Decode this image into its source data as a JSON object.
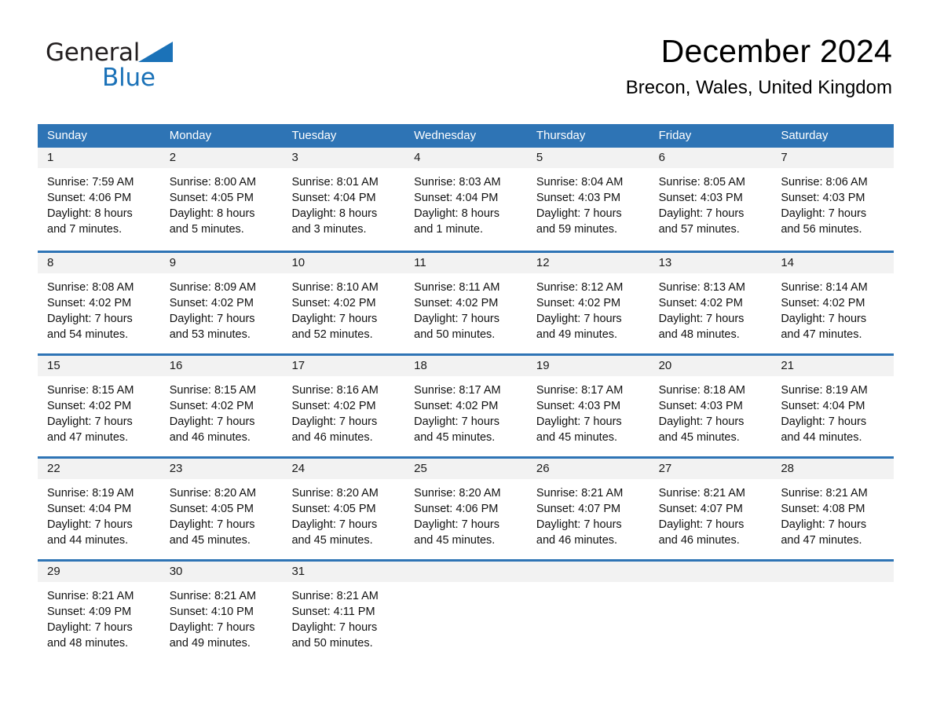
{
  "brand": {
    "name_part1": "General",
    "name_part2": "Blue",
    "accent_color": "#1b72b8"
  },
  "header": {
    "title": "December 2024",
    "subtitle": "Brecon, Wales, United Kingdom"
  },
  "theme": {
    "header_blue": "#2e74b5",
    "day_band_gray": "#f2f2f2",
    "text_black": "#000000"
  },
  "weekdays": [
    "Sunday",
    "Monday",
    "Tuesday",
    "Wednesday",
    "Thursday",
    "Friday",
    "Saturday"
  ],
  "labels": {
    "sunrise_prefix": "Sunrise: ",
    "sunset_prefix": "Sunset: ",
    "daylight_prefix": "Daylight: "
  },
  "weeks": [
    [
      {
        "day": "1",
        "sunrise": "Sunrise: 7:59 AM",
        "sunset": "Sunset: 4:06 PM",
        "daylight1": "Daylight: 8 hours",
        "daylight2": "and 7 minutes."
      },
      {
        "day": "2",
        "sunrise": "Sunrise: 8:00 AM",
        "sunset": "Sunset: 4:05 PM",
        "daylight1": "Daylight: 8 hours",
        "daylight2": "and 5 minutes."
      },
      {
        "day": "3",
        "sunrise": "Sunrise: 8:01 AM",
        "sunset": "Sunset: 4:04 PM",
        "daylight1": "Daylight: 8 hours",
        "daylight2": "and 3 minutes."
      },
      {
        "day": "4",
        "sunrise": "Sunrise: 8:03 AM",
        "sunset": "Sunset: 4:04 PM",
        "daylight1": "Daylight: 8 hours",
        "daylight2": "and 1 minute."
      },
      {
        "day": "5",
        "sunrise": "Sunrise: 8:04 AM",
        "sunset": "Sunset: 4:03 PM",
        "daylight1": "Daylight: 7 hours",
        "daylight2": "and 59 minutes."
      },
      {
        "day": "6",
        "sunrise": "Sunrise: 8:05 AM",
        "sunset": "Sunset: 4:03 PM",
        "daylight1": "Daylight: 7 hours",
        "daylight2": "and 57 minutes."
      },
      {
        "day": "7",
        "sunrise": "Sunrise: 8:06 AM",
        "sunset": "Sunset: 4:03 PM",
        "daylight1": "Daylight: 7 hours",
        "daylight2": "and 56 minutes."
      }
    ],
    [
      {
        "day": "8",
        "sunrise": "Sunrise: 8:08 AM",
        "sunset": "Sunset: 4:02 PM",
        "daylight1": "Daylight: 7 hours",
        "daylight2": "and 54 minutes."
      },
      {
        "day": "9",
        "sunrise": "Sunrise: 8:09 AM",
        "sunset": "Sunset: 4:02 PM",
        "daylight1": "Daylight: 7 hours",
        "daylight2": "and 53 minutes."
      },
      {
        "day": "10",
        "sunrise": "Sunrise: 8:10 AM",
        "sunset": "Sunset: 4:02 PM",
        "daylight1": "Daylight: 7 hours",
        "daylight2": "and 52 minutes."
      },
      {
        "day": "11",
        "sunrise": "Sunrise: 8:11 AM",
        "sunset": "Sunset: 4:02 PM",
        "daylight1": "Daylight: 7 hours",
        "daylight2": "and 50 minutes."
      },
      {
        "day": "12",
        "sunrise": "Sunrise: 8:12 AM",
        "sunset": "Sunset: 4:02 PM",
        "daylight1": "Daylight: 7 hours",
        "daylight2": "and 49 minutes."
      },
      {
        "day": "13",
        "sunrise": "Sunrise: 8:13 AM",
        "sunset": "Sunset: 4:02 PM",
        "daylight1": "Daylight: 7 hours",
        "daylight2": "and 48 minutes."
      },
      {
        "day": "14",
        "sunrise": "Sunrise: 8:14 AM",
        "sunset": "Sunset: 4:02 PM",
        "daylight1": "Daylight: 7 hours",
        "daylight2": "and 47 minutes."
      }
    ],
    [
      {
        "day": "15",
        "sunrise": "Sunrise: 8:15 AM",
        "sunset": "Sunset: 4:02 PM",
        "daylight1": "Daylight: 7 hours",
        "daylight2": "and 47 minutes."
      },
      {
        "day": "16",
        "sunrise": "Sunrise: 8:15 AM",
        "sunset": "Sunset: 4:02 PM",
        "daylight1": "Daylight: 7 hours",
        "daylight2": "and 46 minutes."
      },
      {
        "day": "17",
        "sunrise": "Sunrise: 8:16 AM",
        "sunset": "Sunset: 4:02 PM",
        "daylight1": "Daylight: 7 hours",
        "daylight2": "and 46 minutes."
      },
      {
        "day": "18",
        "sunrise": "Sunrise: 8:17 AM",
        "sunset": "Sunset: 4:02 PM",
        "daylight1": "Daylight: 7 hours",
        "daylight2": "and 45 minutes."
      },
      {
        "day": "19",
        "sunrise": "Sunrise: 8:17 AM",
        "sunset": "Sunset: 4:03 PM",
        "daylight1": "Daylight: 7 hours",
        "daylight2": "and 45 minutes."
      },
      {
        "day": "20",
        "sunrise": "Sunrise: 8:18 AM",
        "sunset": "Sunset: 4:03 PM",
        "daylight1": "Daylight: 7 hours",
        "daylight2": "and 45 minutes."
      },
      {
        "day": "21",
        "sunrise": "Sunrise: 8:19 AM",
        "sunset": "Sunset: 4:04 PM",
        "daylight1": "Daylight: 7 hours",
        "daylight2": "and 44 minutes."
      }
    ],
    [
      {
        "day": "22",
        "sunrise": "Sunrise: 8:19 AM",
        "sunset": "Sunset: 4:04 PM",
        "daylight1": "Daylight: 7 hours",
        "daylight2": "and 44 minutes."
      },
      {
        "day": "23",
        "sunrise": "Sunrise: 8:20 AM",
        "sunset": "Sunset: 4:05 PM",
        "daylight1": "Daylight: 7 hours",
        "daylight2": "and 45 minutes."
      },
      {
        "day": "24",
        "sunrise": "Sunrise: 8:20 AM",
        "sunset": "Sunset: 4:05 PM",
        "daylight1": "Daylight: 7 hours",
        "daylight2": "and 45 minutes."
      },
      {
        "day": "25",
        "sunrise": "Sunrise: 8:20 AM",
        "sunset": "Sunset: 4:06 PM",
        "daylight1": "Daylight: 7 hours",
        "daylight2": "and 45 minutes."
      },
      {
        "day": "26",
        "sunrise": "Sunrise: 8:21 AM",
        "sunset": "Sunset: 4:07 PM",
        "daylight1": "Daylight: 7 hours",
        "daylight2": "and 46 minutes."
      },
      {
        "day": "27",
        "sunrise": "Sunrise: 8:21 AM",
        "sunset": "Sunset: 4:07 PM",
        "daylight1": "Daylight: 7 hours",
        "daylight2": "and 46 minutes."
      },
      {
        "day": "28",
        "sunrise": "Sunrise: 8:21 AM",
        "sunset": "Sunset: 4:08 PM",
        "daylight1": "Daylight: 7 hours",
        "daylight2": "and 47 minutes."
      }
    ],
    [
      {
        "day": "29",
        "sunrise": "Sunrise: 8:21 AM",
        "sunset": "Sunset: 4:09 PM",
        "daylight1": "Daylight: 7 hours",
        "daylight2": "and 48 minutes."
      },
      {
        "day": "30",
        "sunrise": "Sunrise: 8:21 AM",
        "sunset": "Sunset: 4:10 PM",
        "daylight1": "Daylight: 7 hours",
        "daylight2": "and 49 minutes."
      },
      {
        "day": "31",
        "sunrise": "Sunrise: 8:21 AM",
        "sunset": "Sunset: 4:11 PM",
        "daylight1": "Daylight: 7 hours",
        "daylight2": "and 50 minutes."
      },
      {
        "day": "",
        "sunrise": "",
        "sunset": "",
        "daylight1": "",
        "daylight2": ""
      },
      {
        "day": "",
        "sunrise": "",
        "sunset": "",
        "daylight1": "",
        "daylight2": ""
      },
      {
        "day": "",
        "sunrise": "",
        "sunset": "",
        "daylight1": "",
        "daylight2": ""
      },
      {
        "day": "",
        "sunrise": "",
        "sunset": "",
        "daylight1": "",
        "daylight2": ""
      }
    ]
  ]
}
